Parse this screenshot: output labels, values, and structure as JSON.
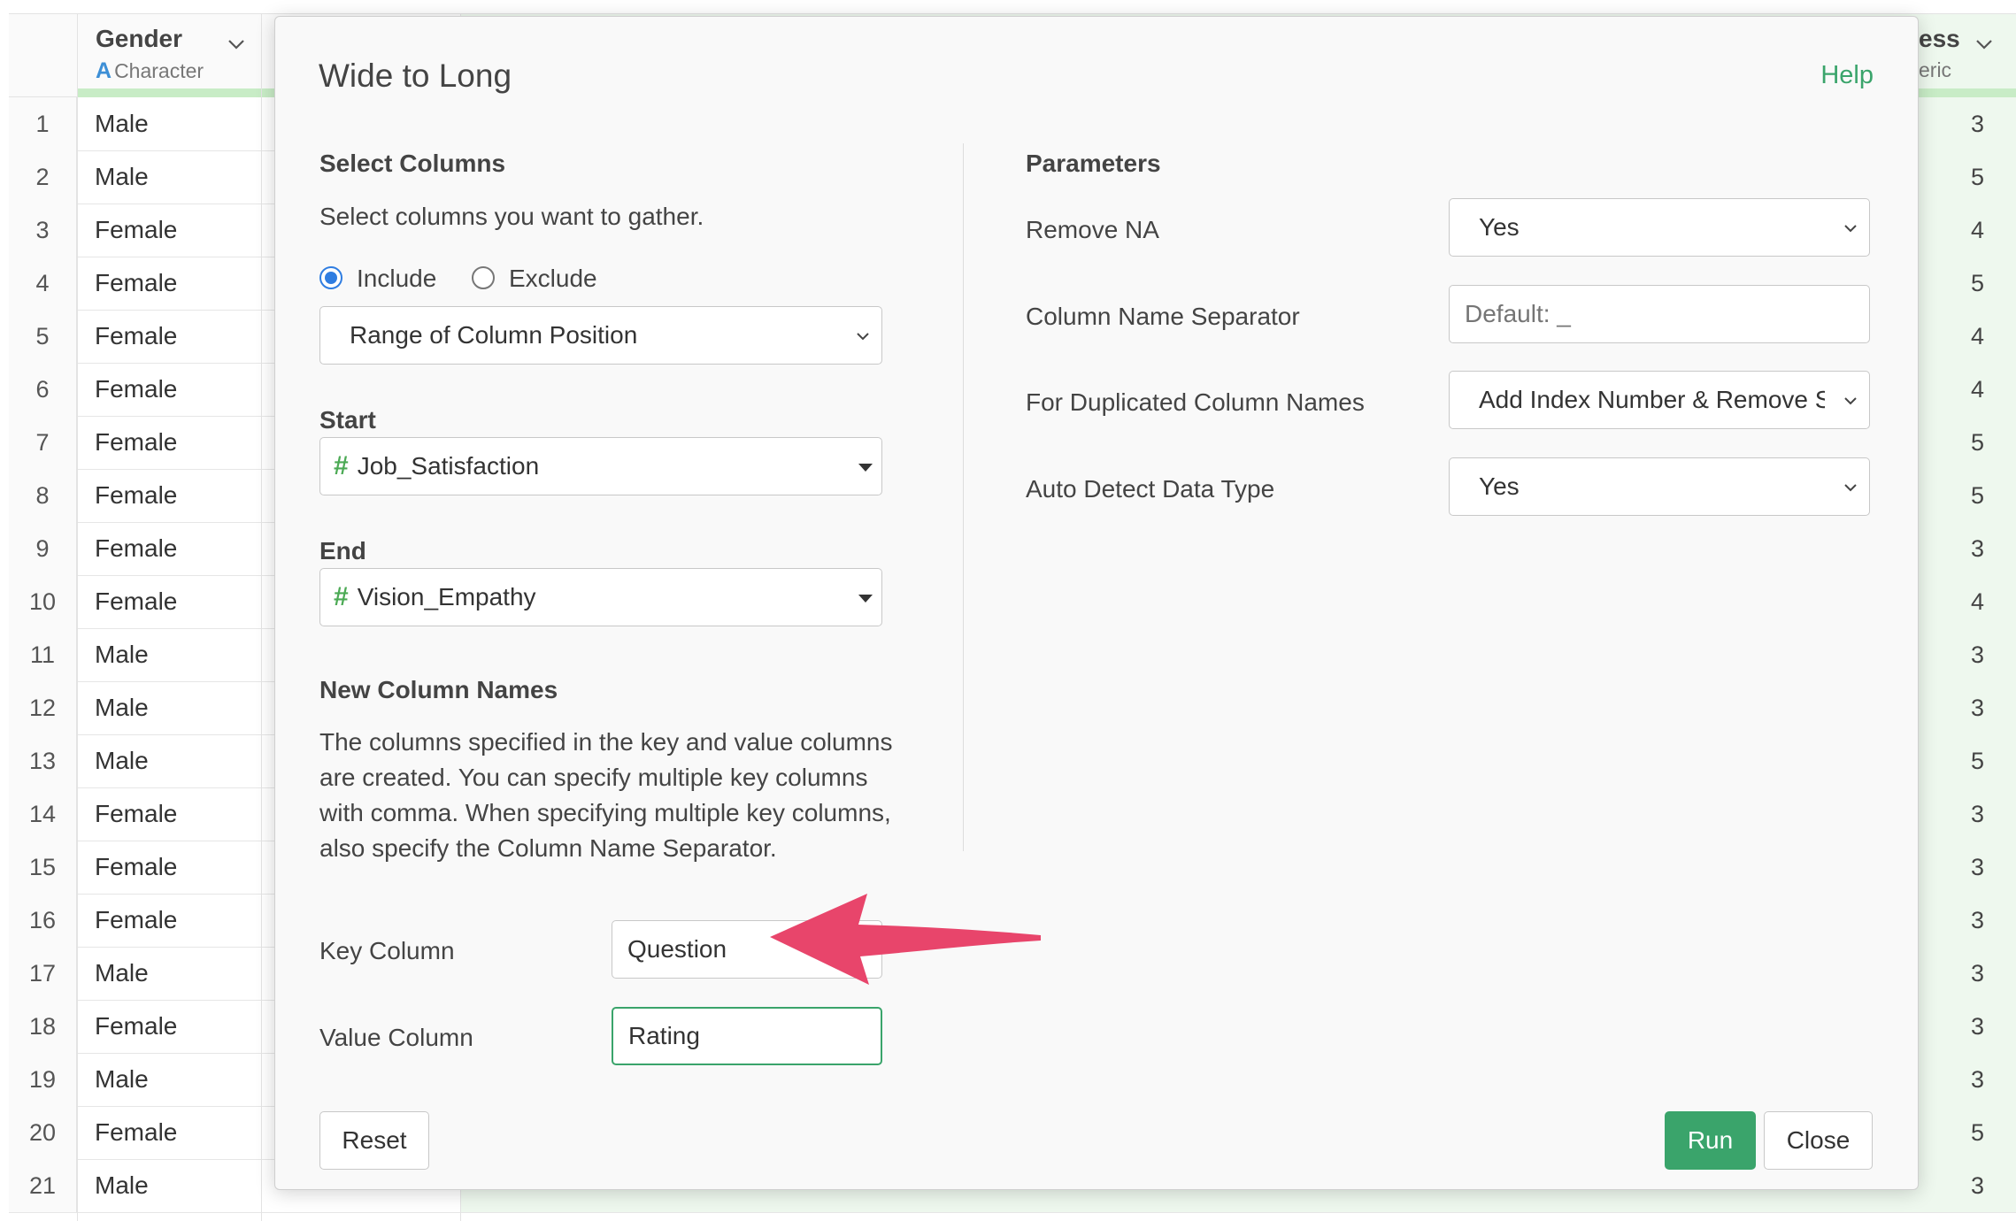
{
  "grid": {
    "first_column": {
      "name": "Gender",
      "type_icon": "A",
      "type": "Character"
    },
    "last_column": {
      "name_fragment": "ess",
      "type_fragment": "eric"
    },
    "rows": [
      {
        "num": "1",
        "gender": "Male",
        "value": "3"
      },
      {
        "num": "2",
        "gender": "Male",
        "value": "5"
      },
      {
        "num": "3",
        "gender": "Female",
        "value": "4"
      },
      {
        "num": "4",
        "gender": "Female",
        "value": "5"
      },
      {
        "num": "5",
        "gender": "Female",
        "value": "4"
      },
      {
        "num": "6",
        "gender": "Female",
        "value": "4"
      },
      {
        "num": "7",
        "gender": "Female",
        "value": "5"
      },
      {
        "num": "8",
        "gender": "Female",
        "value": "5"
      },
      {
        "num": "9",
        "gender": "Female",
        "value": "3"
      },
      {
        "num": "10",
        "gender": "Female",
        "value": "4"
      },
      {
        "num": "11",
        "gender": "Male",
        "value": "3"
      },
      {
        "num": "12",
        "gender": "Male",
        "value": "3"
      },
      {
        "num": "13",
        "gender": "Male",
        "value": "5"
      },
      {
        "num": "14",
        "gender": "Female",
        "value": "3"
      },
      {
        "num": "15",
        "gender": "Female",
        "value": "3"
      },
      {
        "num": "16",
        "gender": "Female",
        "value": "3"
      },
      {
        "num": "17",
        "gender": "Male",
        "value": "3"
      },
      {
        "num": "18",
        "gender": "Female",
        "value": "3"
      },
      {
        "num": "19",
        "gender": "Male",
        "value": "3"
      },
      {
        "num": "20",
        "gender": "Female",
        "value": "5"
      },
      {
        "num": "21",
        "gender": "Male",
        "value": "3"
      }
    ]
  },
  "dialog": {
    "title": "Wide to Long",
    "help_label": "Help",
    "select_columns": {
      "heading": "Select Columns",
      "description": "Select columns you want to gather.",
      "include_label": "Include",
      "exclude_label": "Exclude",
      "selected_mode": "Include",
      "method_value": "Range of Column Position",
      "start_label": "Start",
      "start_value": "Job_Satisfaction",
      "end_label": "End",
      "end_value": "Vision_Empathy"
    },
    "new_column_names": {
      "heading": "New Column Names",
      "description": "The columns specified in the key and value columns are created. You can specify multiple key columns with comma. When specifying multiple key columns, also specify the Column Name Separator.",
      "key_label": "Key Column",
      "key_value": "Question",
      "value_label": "Value Column",
      "value_value": "Rating"
    },
    "parameters": {
      "heading": "Parameters",
      "remove_na_label": "Remove NA",
      "remove_na_value": "Yes",
      "separator_label": "Column Name Separator",
      "separator_placeholder": "Default: _",
      "duplicated_label": "For Duplicated Column Names",
      "duplicated_value": "Add Index Number & Remove S",
      "auto_detect_label": "Auto Detect Data Type",
      "auto_detect_value": "Yes"
    },
    "buttons": {
      "reset": "Reset",
      "run": "Run",
      "close": "Close"
    }
  },
  "colors": {
    "accent": "#3aa46b",
    "arrow": "#e8456b",
    "radio": "#2f7de1",
    "grid_green": "#eef8ee"
  }
}
